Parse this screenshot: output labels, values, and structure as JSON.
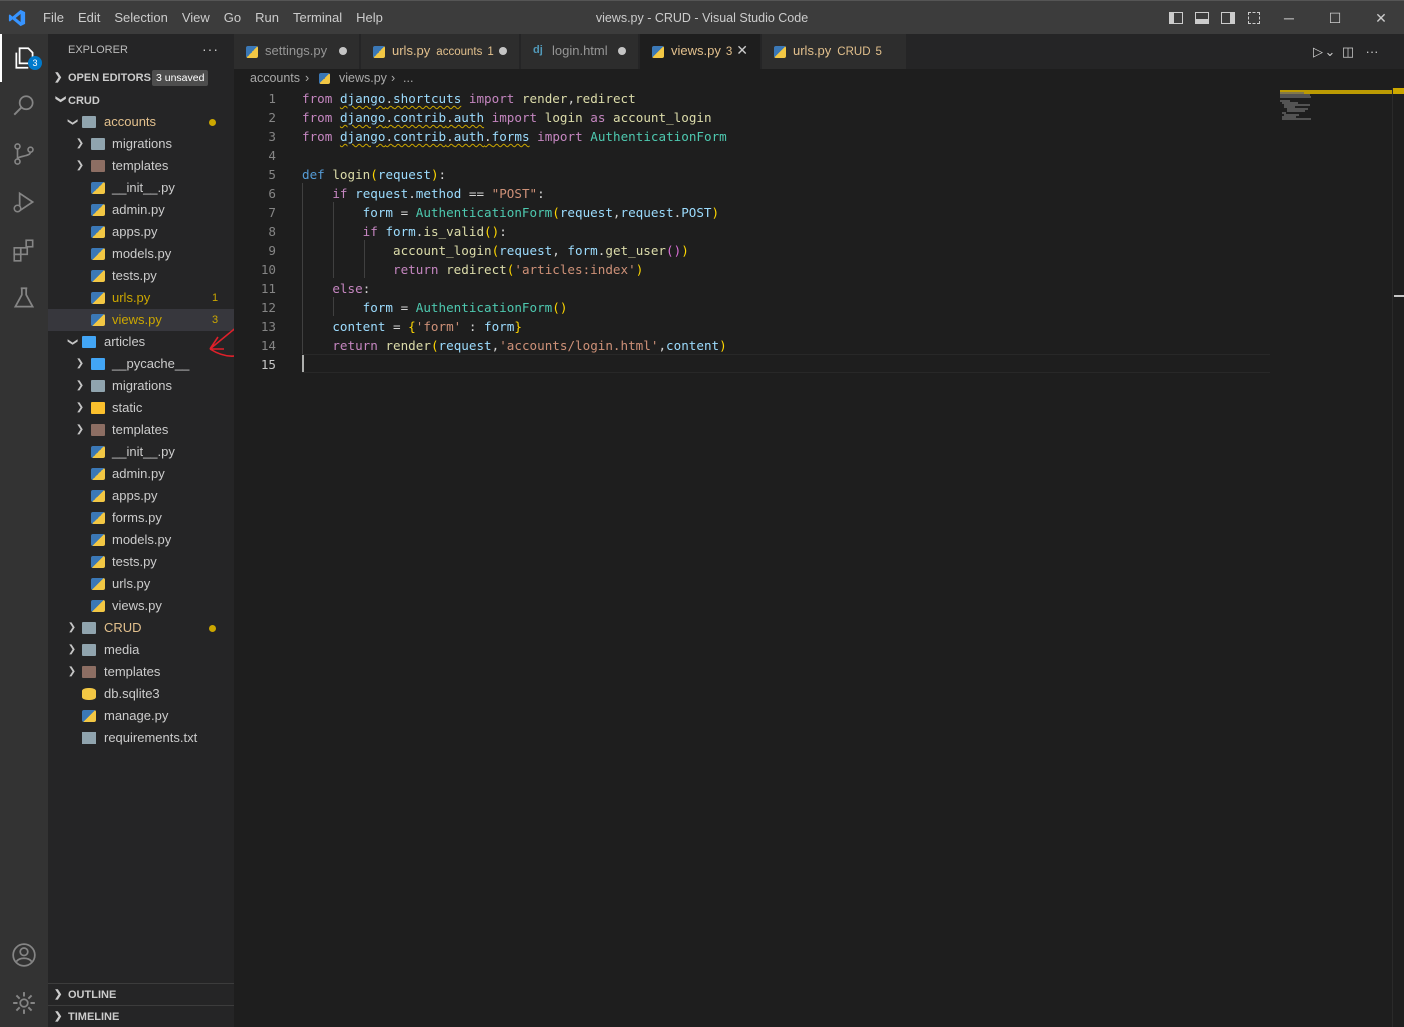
{
  "titlebar": {
    "window_title": "views.py - CRUD - Visual Studio Code",
    "menu": [
      "File",
      "Edit",
      "Selection",
      "View",
      "Go",
      "Run",
      "Terminal",
      "Help"
    ],
    "controls": {
      "minimize": "─",
      "maximize": "☐",
      "close": "✕"
    }
  },
  "activitybar": {
    "explorer_badge": "3",
    "icons": [
      "files-icon",
      "search-icon",
      "source-control-icon",
      "run-debug-icon",
      "extensions-icon",
      "testing-icon",
      "account-icon",
      "settings-gear-icon"
    ]
  },
  "sidebar": {
    "header": "EXPLORER",
    "more": "···",
    "open_editors": {
      "label": "OPEN EDITORS",
      "unsaved": "3 unsaved"
    },
    "workspace": "CRUD",
    "tree": [
      {
        "name": "accounts",
        "type": "folder-open",
        "depth": 1,
        "dot": true,
        "color": "#e2c08d"
      },
      {
        "name": "migrations",
        "type": "folder",
        "depth": 2
      },
      {
        "name": "templates",
        "type": "folder-tpl",
        "depth": 2
      },
      {
        "name": "__init__.py",
        "type": "py",
        "depth": 2
      },
      {
        "name": "admin.py",
        "type": "py",
        "depth": 2
      },
      {
        "name": "apps.py",
        "type": "py",
        "depth": 2
      },
      {
        "name": "models.py",
        "type": "py",
        "depth": 2
      },
      {
        "name": "tests.py",
        "type": "py",
        "depth": 2
      },
      {
        "name": "urls.py",
        "type": "py",
        "depth": 2,
        "badge": "1",
        "color": "#cca700"
      },
      {
        "name": "views.py",
        "type": "py",
        "depth": 2,
        "badge": "3",
        "color": "#cca700",
        "selected": true
      },
      {
        "name": "articles",
        "type": "folder-open-blue",
        "depth": 1
      },
      {
        "name": "__pycache__",
        "type": "folder-blue",
        "depth": 2
      },
      {
        "name": "migrations",
        "type": "folder",
        "depth": 2
      },
      {
        "name": "static",
        "type": "folder-yel",
        "depth": 2
      },
      {
        "name": "templates",
        "type": "folder-tpl",
        "depth": 2
      },
      {
        "name": "__init__.py",
        "type": "py",
        "depth": 2
      },
      {
        "name": "admin.py",
        "type": "py",
        "depth": 2
      },
      {
        "name": "apps.py",
        "type": "py",
        "depth": 2
      },
      {
        "name": "forms.py",
        "type": "py",
        "depth": 2
      },
      {
        "name": "models.py",
        "type": "py",
        "depth": 2
      },
      {
        "name": "tests.py",
        "type": "py",
        "depth": 2
      },
      {
        "name": "urls.py",
        "type": "py",
        "depth": 2
      },
      {
        "name": "views.py",
        "type": "py",
        "depth": 2
      },
      {
        "name": "CRUD",
        "type": "folder",
        "depth": 1,
        "dot": true,
        "color": "#e2c08d"
      },
      {
        "name": "media",
        "type": "folder",
        "depth": 1
      },
      {
        "name": "templates",
        "type": "folder-tpl",
        "depth": 1
      },
      {
        "name": "db.sqlite3",
        "type": "db",
        "depth": 1
      },
      {
        "name": "manage.py",
        "type": "py",
        "depth": 1
      },
      {
        "name": "requirements.txt",
        "type": "txt",
        "depth": 1
      }
    ],
    "outline": "OUTLINE",
    "timeline": "TIMELINE"
  },
  "tabs": [
    {
      "name": "settings.py",
      "desc": "",
      "state": "dot",
      "active": false
    },
    {
      "name": "urls.py",
      "desc": "accounts",
      "count": "1",
      "state": "dot",
      "active": false,
      "color": "#e2c08d"
    },
    {
      "name": "login.html",
      "desc": "",
      "state": "dot",
      "active": false,
      "icon": "dj"
    },
    {
      "name": "views.py",
      "desc": "",
      "count": "3",
      "state": "close",
      "active": true,
      "color": "#e2c08d"
    },
    {
      "name": "urls.py",
      "desc": "CRUD",
      "count": "5",
      "state": "none",
      "active": false,
      "color": "#e2c08d"
    }
  ],
  "editor_actions": {
    "run": "▷",
    "run_dropdown": "⌄",
    "split": "◫",
    "more": "···"
  },
  "breadcrumb": {
    "folder": "accounts",
    "sep": "›",
    "file": "views.py",
    "tail": "..."
  },
  "code": {
    "lines": [
      "from django.shortcuts import render,redirect",
      "from django.contrib.auth import login as account_login",
      "from django.contrib.auth.forms import AuthenticationForm",
      "",
      "def login(request):",
      "    if request.method == \"POST\":",
      "        form = AuthenticationForm(request,request.POST)",
      "        if form.is_valid():",
      "            account_login(request, form.get_user())",
      "            return redirect('articles:index')",
      "    else:",
      "        form = AuthenticationForm()",
      "    content = {'form' : form}",
      "    return render(request,'accounts/login.html',content)",
      ""
    ],
    "current_line": 15
  }
}
